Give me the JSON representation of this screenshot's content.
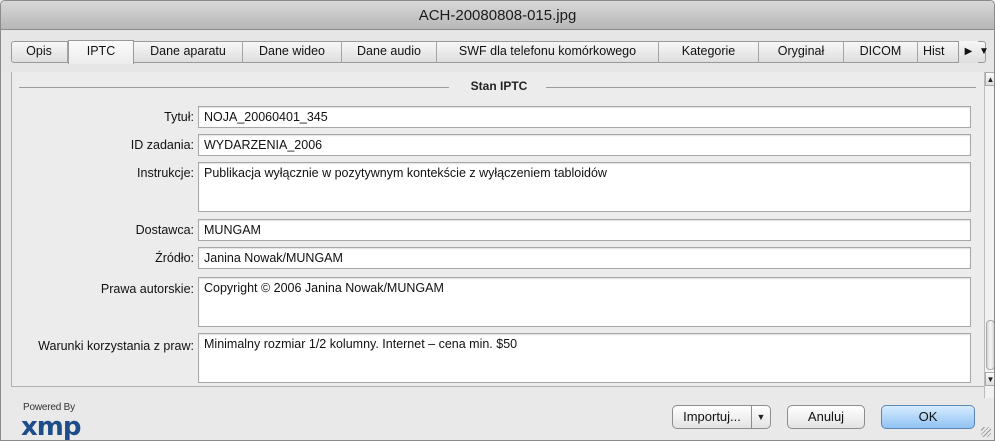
{
  "window": {
    "title": "ACH-20080808-015.jpg"
  },
  "tabs": [
    {
      "label": "Opis"
    },
    {
      "label": "IPTC"
    },
    {
      "label": "Dane aparatu"
    },
    {
      "label": "Dane wideo"
    },
    {
      "label": "Dane audio"
    },
    {
      "label": "SWF dla telefonu komórkowego"
    },
    {
      "label": "Kategorie"
    },
    {
      "label": "Oryginał"
    },
    {
      "label": "DICOM"
    },
    {
      "label": "Hist"
    }
  ],
  "active_tab": "IPTC",
  "section": {
    "title": "Stan IPTC"
  },
  "fields": [
    {
      "label": "Tytuł:",
      "value": "NOJA_20060401_345"
    },
    {
      "label": "ID zadania:",
      "value": "WYDARZENIA_2006"
    },
    {
      "label": "Instrukcje:",
      "value": "Publikacja wyłącznie w pozytywnym kontekście z wyłączeniem tabloidów"
    },
    {
      "label": "Dostawca:",
      "value": "MUNGAM"
    },
    {
      "label": "Źródło:",
      "value": "Janina Nowak/MUNGAM"
    },
    {
      "label": "Prawa autorskie:",
      "value": "Copyright © 2006 Janina Nowak/MUNGAM"
    },
    {
      "label": "Warunki korzystania z praw:",
      "value": "Minimalny rozmiar 1/2 kolumny. Internet – cena min. $50"
    }
  ],
  "footer": {
    "powered_by": "Powered By",
    "logo_text": "xmp",
    "import_label": "Importuj...",
    "cancel_label": "Anuluj",
    "ok_label": "OK"
  },
  "icons": {
    "tab_scroll_right": "chevron-right-icon",
    "tab_scroll_down": "chevron-down-icon",
    "scroll_up": "arrow-up-icon",
    "scroll_down": "arrow-down-icon",
    "import_menu": "chevron-down-icon"
  }
}
